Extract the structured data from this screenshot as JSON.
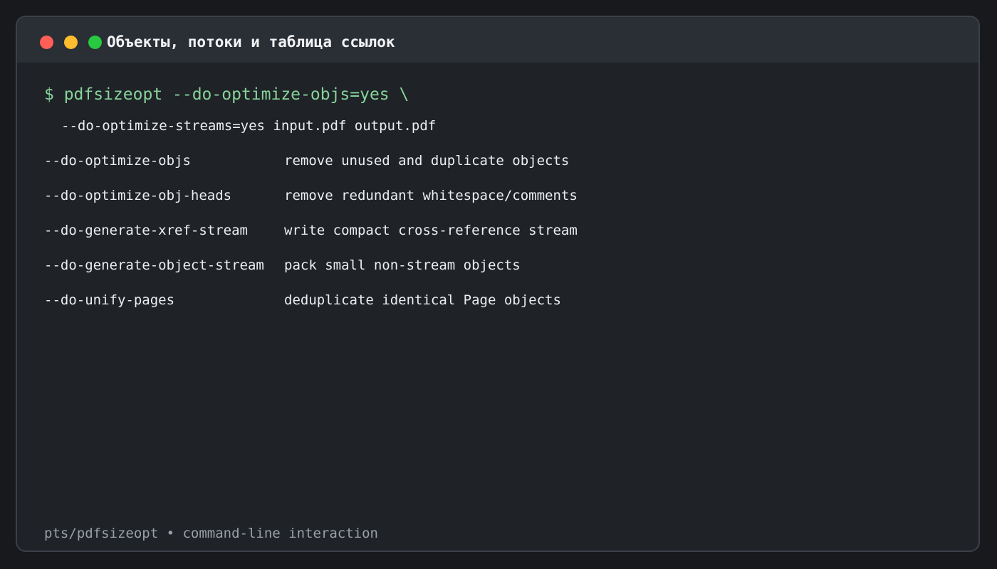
{
  "window": {
    "title": "Объекты, потоки и таблица ссылок",
    "controls": [
      "close",
      "minimize",
      "maximize"
    ]
  },
  "terminal": {
    "command": "$ pdfsizeopt --do-optimize-objs=yes \\",
    "continuation": "--do-optimize-streams=yes input.pdf output.pdf",
    "options": [
      {
        "flag": "--do-optimize-objs",
        "description": "remove unused and duplicate objects"
      },
      {
        "flag": "--do-optimize-obj-heads",
        "description": "remove redundant whitespace/comments"
      },
      {
        "flag": "--do-generate-xref-stream",
        "description": "write compact cross-reference stream"
      },
      {
        "flag": "--do-generate-object-stream",
        "description": "pack small non-stream objects"
      },
      {
        "flag": "--do-unify-pages",
        "description": "deduplicate identical Page objects"
      }
    ]
  },
  "footer": {
    "text": "pts/pdfsizeopt • command-line interaction"
  },
  "colors": {
    "background": "#17191d",
    "window": "#1f2227",
    "titlebar": "#2a2e35",
    "prompt": "#86d39a",
    "text": "#eceef1",
    "muted": "#9aa0a8",
    "close": "#ff5f57",
    "minimize": "#febc2e",
    "maximize": "#28c840"
  }
}
